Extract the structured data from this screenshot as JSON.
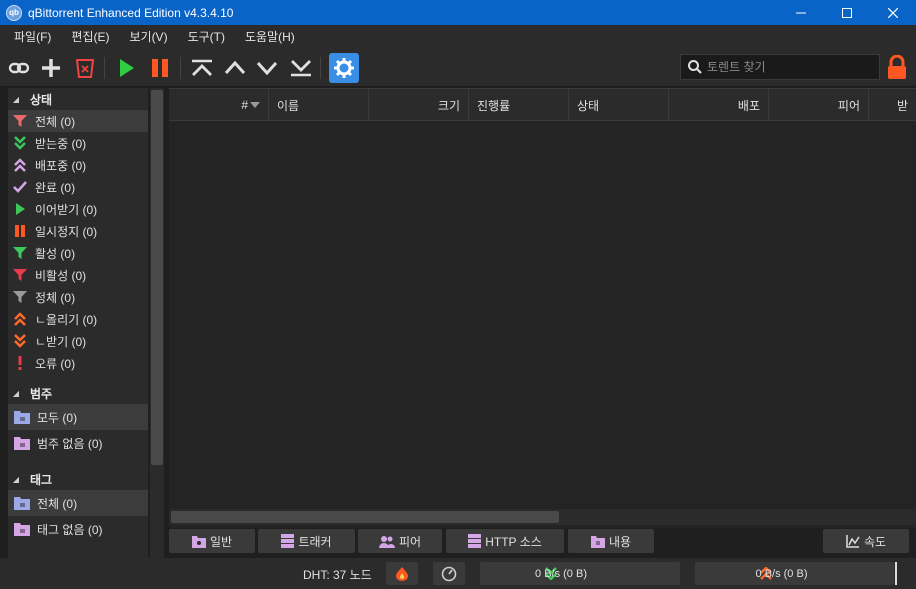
{
  "window": {
    "title": "qBittorrent Enhanced Edition v4.3.4.10",
    "app_icon_text": "qb",
    "minimize": "─",
    "maximize": "☐",
    "close": "✕"
  },
  "menu": [
    "파일(F)",
    "편집(E)",
    "보기(V)",
    "도구(T)",
    "도움말(H)"
  ],
  "toolbar": {
    "search_placeholder": "토렌트 찾기",
    "buttons": [
      "add-link",
      "add-torrent",
      "delete",
      "resume",
      "pause",
      "move-top",
      "move-up",
      "move-down",
      "move-bottom",
      "options"
    ],
    "accent": "#3a8ee6"
  },
  "sidebar": {
    "status_header": "상태",
    "status_items": [
      {
        "label": "전체 (0)",
        "icon": "filter-icon"
      },
      {
        "label": "받는중 (0)",
        "icon": "double-chevron-down-icon"
      },
      {
        "label": "배포중 (0)",
        "icon": "double-chevron-up-icon"
      },
      {
        "label": "완료 (0)",
        "icon": "check-icon"
      },
      {
        "label": "이어받기 (0)",
        "icon": "play-icon"
      },
      {
        "label": "일시정지 (0)",
        "icon": "pause-icon"
      },
      {
        "label": "활성 (0)",
        "icon": "filter-green-icon"
      },
      {
        "label": "비활성 (0)",
        "icon": "filter-red-icon"
      },
      {
        "label": "정체 (0)",
        "icon": "filter-grey-icon"
      },
      {
        "label": "ㄴ올리기 (0)",
        "icon": "upload-orange-icon"
      },
      {
        "label": "ㄴ받기 (0)",
        "icon": "download-orange-icon"
      },
      {
        "label": "오류 (0)",
        "icon": "error-icon"
      }
    ],
    "category_header": "범주",
    "category_items": [
      {
        "label": "모두 (0)"
      },
      {
        "label": "범주 없음 (0)"
      }
    ],
    "tag_header": "태그",
    "tag_items": [
      {
        "label": "전체 (0)"
      },
      {
        "label": "태그 없음 (0)"
      }
    ]
  },
  "table": {
    "columns": [
      "#",
      "이름",
      "크기",
      "진행률",
      "상태",
      "배포",
      "피어",
      "받"
    ]
  },
  "bottom_tabs": [
    "일반",
    "트래커",
    "피어",
    "HTTP 소스",
    "내용",
    "속도"
  ],
  "status": {
    "dht": "DHT: 37 노드",
    "download": "0 B/s (0 B)",
    "upload": "0 B/s (0 B)"
  }
}
